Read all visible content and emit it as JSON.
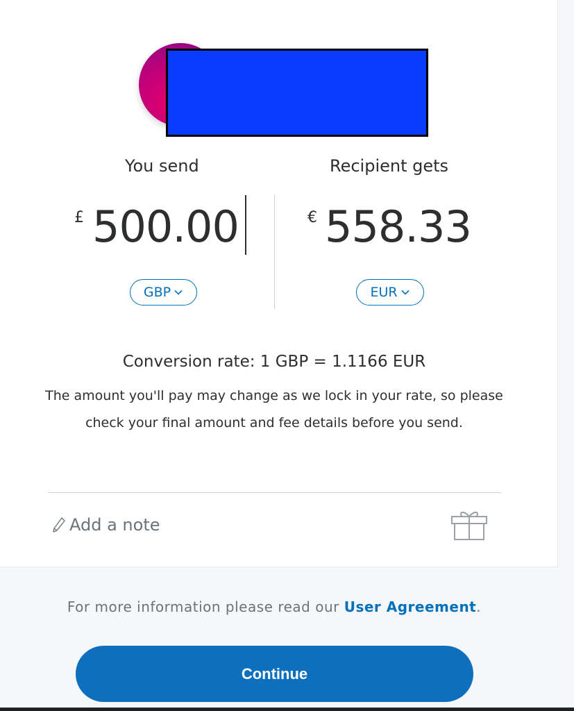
{
  "recipient": {
    "avatar_icon": "recipient-avatar",
    "avatar_color": "#c1007a",
    "redaction_color": "#0a3cff"
  },
  "send": {
    "label": "You send",
    "currency_symbol": "£",
    "amount": "500.00",
    "currency_code": "GBP"
  },
  "receive": {
    "label": "Recipient gets",
    "currency_symbol": "€",
    "amount": "558.33",
    "currency_code": "EUR"
  },
  "conversion": {
    "rate_text": "Conversion rate: 1 GBP = 1.1166 EUR",
    "disclaimer_line1": "The amount you'll pay may change as we lock in your rate, so please",
    "disclaimer_line2": "check your final amount and fee details before you send."
  },
  "note": {
    "label": "Add a note",
    "icon": "pencil-icon",
    "gift_icon": "gift-icon"
  },
  "footer": {
    "info_prefix": "For more information please read our ",
    "link_label": "User Agreement",
    "info_suffix": "."
  },
  "actions": {
    "continue_label": "Continue"
  },
  "colors": {
    "accent": "#0070ba",
    "button": "#0e6fbe",
    "text": "#2c2e2f",
    "muted": "#6c7378"
  }
}
